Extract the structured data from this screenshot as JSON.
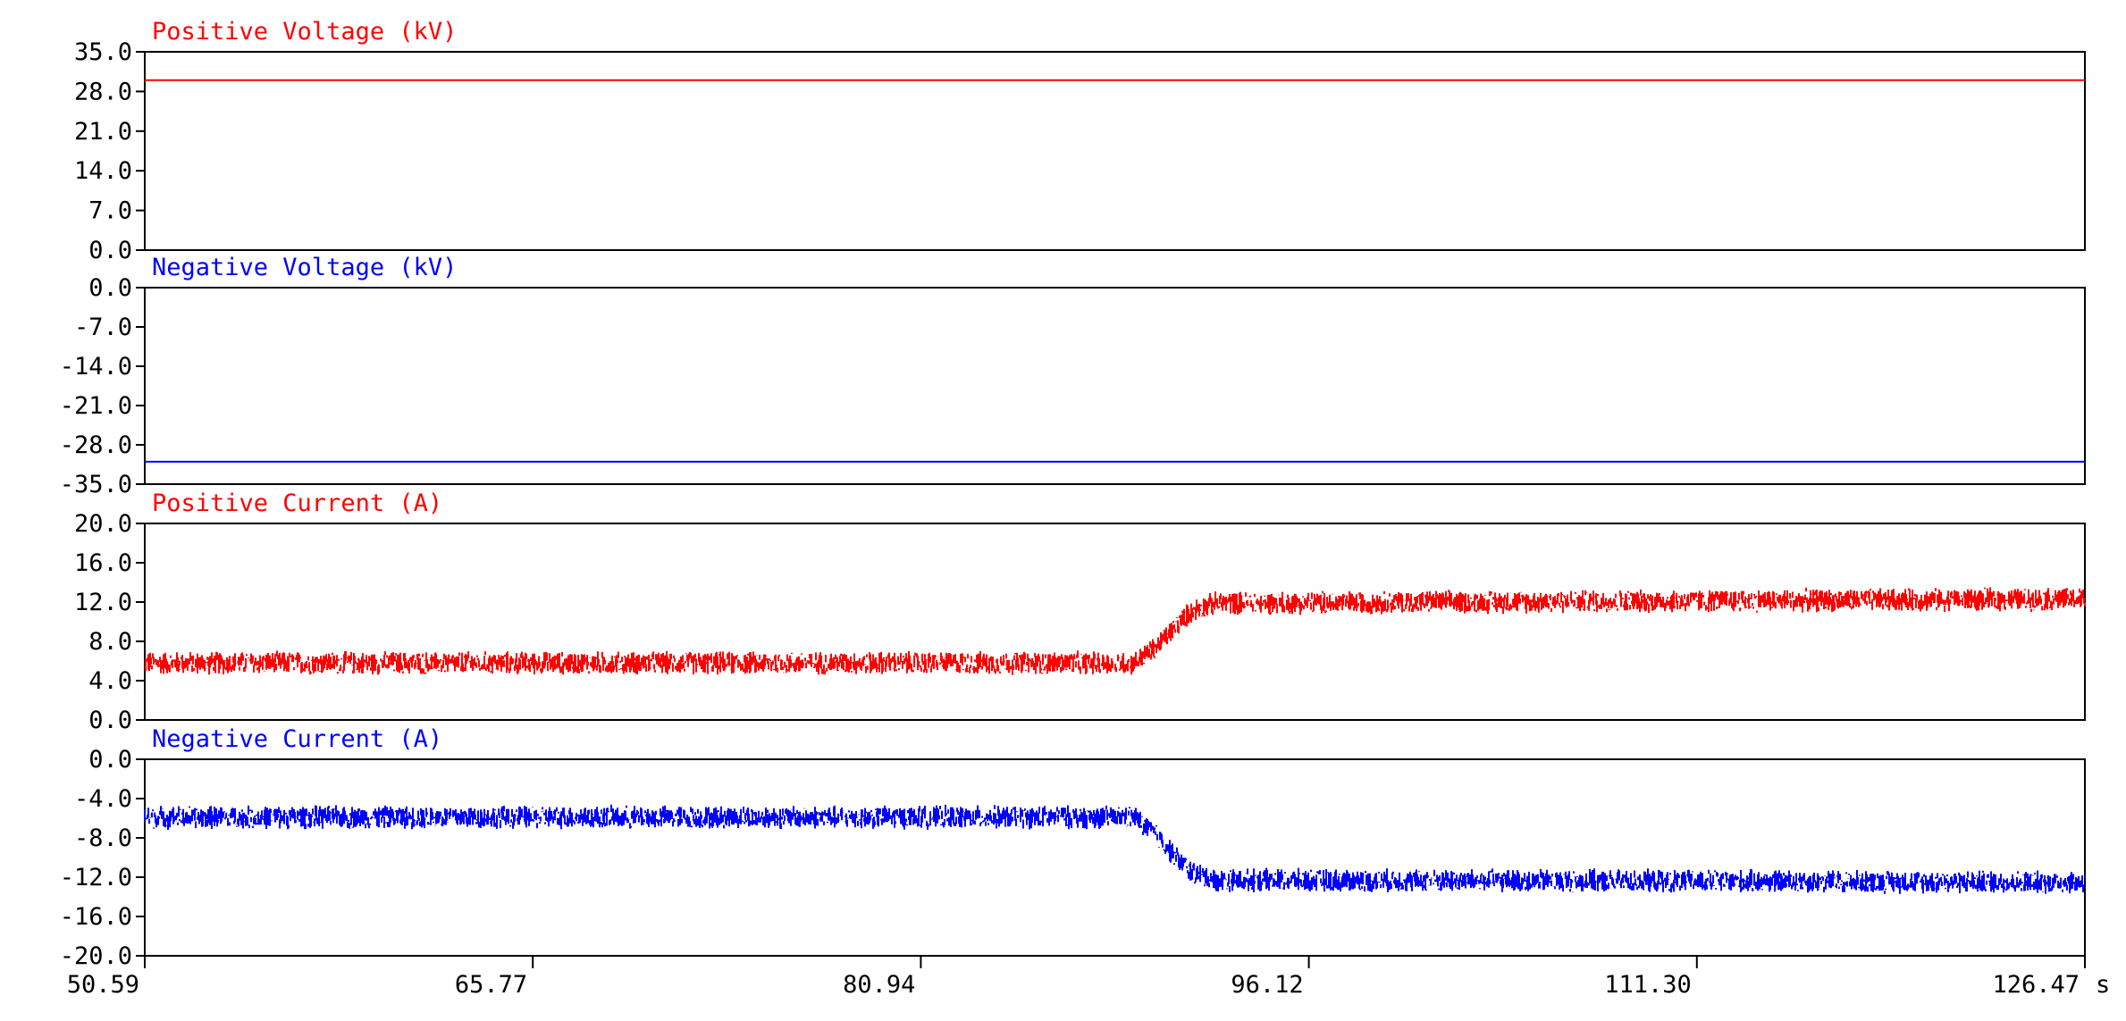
{
  "chart_data": [
    {
      "type": "line",
      "title": "Positive Voltage (kV)",
      "ylim": [
        0,
        35
      ],
      "yticks": [
        "35.0",
        "28.0",
        "21.0",
        "14.0",
        "7.0",
        "0.0"
      ],
      "color": "#ff0000",
      "series": [
        {
          "x": [
            50.59,
            126.47
          ],
          "y": [
            30.0,
            30.0
          ]
        }
      ]
    },
    {
      "type": "line",
      "title": "Negative Voltage (kV)",
      "ylim": [
        -35,
        0
      ],
      "yticks": [
        "0.0",
        "-7.0",
        "-14.0",
        "-21.0",
        "-28.0",
        "-35.0"
      ],
      "color": "#0000ff",
      "series": [
        {
          "x": [
            50.59,
            126.47
          ],
          "y": [
            -31.0,
            -31.0
          ]
        }
      ]
    },
    {
      "type": "line",
      "title": "Positive Current (A)",
      "ylim": [
        0,
        20
      ],
      "yticks": [
        "20.0",
        "16.0",
        "12.0",
        "8.0",
        "4.0",
        "0.0"
      ],
      "color": "#ff0000",
      "noise": 1.0,
      "series": [
        {
          "x": [
            50.59,
            89.3,
            90.2,
            91.0,
            91.6,
            92.5,
            126.47
          ],
          "y": [
            5.8,
            5.8,
            7.5,
            9.8,
            11.2,
            11.9,
            12.3
          ]
        }
      ]
    },
    {
      "type": "line",
      "title": "Negative Current (A)",
      "ylim": [
        -20,
        0
      ],
      "yticks": [
        "0.0",
        "-4.0",
        "-8.0",
        "-12.0",
        "-16.0",
        "-20.0"
      ],
      "color": "#0000ff",
      "noise": 1.0,
      "series": [
        {
          "x": [
            50.59,
            89.3,
            90.2,
            91.0,
            91.6,
            92.5,
            126.47
          ],
          "y": [
            -5.9,
            -5.9,
            -7.8,
            -10.2,
            -11.6,
            -12.3,
            -12.5
          ]
        }
      ]
    }
  ],
  "xaxis": {
    "xlim": [
      50.59,
      126.47
    ],
    "ticks": [
      "50.59",
      "65.77",
      "80.94",
      "96.12",
      "111.30",
      "126.47"
    ],
    "unit": "s"
  }
}
